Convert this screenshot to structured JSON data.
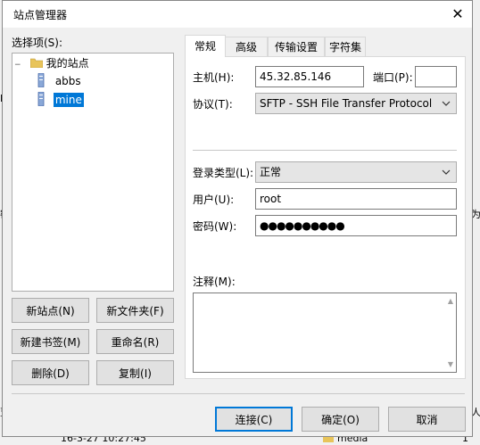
{
  "background": {
    "left_fragments": [
      "le",
      "密",
      "亶"
    ],
    "right_fragments": [
      "为",
      "人"
    ],
    "bottom_timestamp": "16-3-27 10:27:45",
    "bottom_folder": "media",
    "bottom_right": "1"
  },
  "dialog": {
    "title": "站点管理器",
    "close_glyph": "✕"
  },
  "left_panel": {
    "select_label": "选择项(S):",
    "tree": {
      "root": "我的站点",
      "items": [
        "abbs",
        "mine"
      ],
      "selected": "mine"
    },
    "buttons": {
      "new_site": "新站点(N)",
      "new_folder": "新文件夹(F)",
      "new_bookmark": "新建书签(M)",
      "rename": "重命名(R)",
      "delete": "删除(D)",
      "copy": "复制(I)"
    }
  },
  "tabs": [
    "常规",
    "高级",
    "传输设置",
    "字符集"
  ],
  "general": {
    "host_label": "主机(H):",
    "host_value": "45.32.85.146",
    "port_label": "端口(P):",
    "port_value": "",
    "protocol_label": "协议(T):",
    "protocol_value": "SFTP - SSH File Transfer Protocol",
    "logon_label": "登录类型(L):",
    "logon_value": "正常",
    "user_label": "用户(U):",
    "user_value": "root",
    "password_label": "密码(W):",
    "password_value": "●●●●●●●●●●",
    "comment_label": "注释(M):"
  },
  "footer": {
    "connect": "连接(C)",
    "ok": "确定(O)",
    "cancel": "取消"
  },
  "colors": {
    "selection": "#0078d7",
    "dialog_bg": "#f0f0f0"
  }
}
